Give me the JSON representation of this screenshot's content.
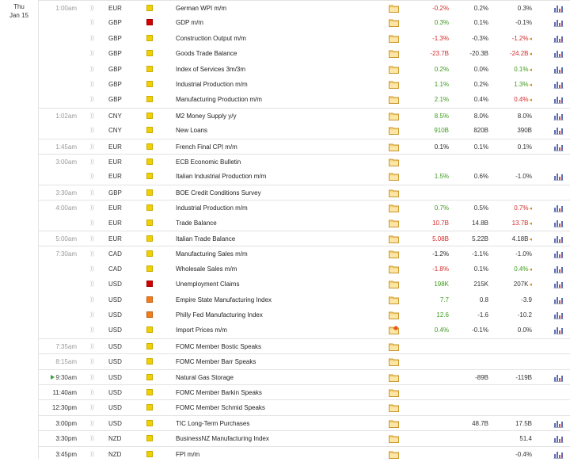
{
  "day": {
    "weekday": "Thu",
    "date": "Jan 15"
  },
  "colors": {
    "positive": "#3c9a1c",
    "negative": "#d42a2a",
    "low_impact": "#f0d000",
    "medium_impact": "#f07c1c",
    "high_impact": "#d40000"
  },
  "icons": {
    "speaker": "speaker-icon",
    "document": "document-icon",
    "chart": "bar-chart-icon",
    "live": "play-icon",
    "revised": "revised-flag-icon"
  },
  "rows": [
    {
      "time": "1:00am",
      "ccy": "EUR",
      "impact": "low",
      "event": "German WPI m/m",
      "actual": "-0.2%",
      "actual_dir": "neg",
      "forecast": "0.2%",
      "previous": "0.3%",
      "rev": false,
      "chart": true,
      "group": true
    },
    {
      "time": "",
      "ccy": "GBP",
      "impact": "high",
      "event": "GDP m/m",
      "actual": "0.3%",
      "actual_dir": "pos",
      "forecast": "0.1%",
      "previous": "-0.1%",
      "rev": false,
      "chart": true
    },
    {
      "time": "",
      "ccy": "GBP",
      "impact": "low",
      "event": "Construction Output m/m",
      "actual": "-1.3%",
      "actual_dir": "neg",
      "forecast": "-0.3%",
      "previous": "-1.2%",
      "previous_dir": "neg",
      "rev": true,
      "chart": true
    },
    {
      "time": "",
      "ccy": "GBP",
      "impact": "low",
      "event": "Goods Trade Balance",
      "actual": "-23.7B",
      "actual_dir": "neg",
      "forecast": "-20.3B",
      "previous": "-24.2B",
      "previous_dir": "neg",
      "rev": true,
      "chart": true
    },
    {
      "time": "",
      "ccy": "GBP",
      "impact": "low",
      "event": "Index of Services 3m/3m",
      "actual": "0.2%",
      "actual_dir": "pos",
      "forecast": "0.0%",
      "previous": "0.1%",
      "previous_dir": "pos",
      "rev": true,
      "chart": true
    },
    {
      "time": "",
      "ccy": "GBP",
      "impact": "low",
      "event": "Industrial Production m/m",
      "actual": "1.1%",
      "actual_dir": "pos",
      "forecast": "0.2%",
      "previous": "1.3%",
      "previous_dir": "pos",
      "rev": true,
      "chart": true
    },
    {
      "time": "",
      "ccy": "GBP",
      "impact": "low",
      "event": "Manufacturing Production m/m",
      "actual": "2.1%",
      "actual_dir": "pos",
      "forecast": "0.4%",
      "previous": "0.4%",
      "previous_dir": "neg",
      "rev": true,
      "chart": true
    },
    {
      "time": "1:02am",
      "ccy": "CNY",
      "impact": "low",
      "event": "M2 Money Supply y/y",
      "actual": "8.5%",
      "actual_dir": "pos",
      "forecast": "8.0%",
      "previous": "8.0%",
      "rev": false,
      "chart": true,
      "group": true
    },
    {
      "time": "",
      "ccy": "CNY",
      "impact": "low",
      "event": "New Loans",
      "actual": "910B",
      "actual_dir": "pos",
      "forecast": "820B",
      "previous": "390B",
      "rev": false,
      "chart": true
    },
    {
      "time": "1:45am",
      "ccy": "EUR",
      "impact": "low",
      "event": "French Final CPI m/m",
      "actual": "0.1%",
      "actual_dir": "",
      "forecast": "0.1%",
      "previous": "0.1%",
      "rev": false,
      "chart": true,
      "group": true
    },
    {
      "time": "3:00am",
      "ccy": "EUR",
      "impact": "low",
      "event": "ECB Economic Bulletin",
      "actual": "",
      "forecast": "",
      "previous": "",
      "rev": false,
      "chart": false,
      "group": true
    },
    {
      "time": "",
      "ccy": "EUR",
      "impact": "low",
      "event": "Italian Industrial Production m/m",
      "actual": "1.5%",
      "actual_dir": "pos",
      "forecast": "0.6%",
      "previous": "-1.0%",
      "rev": false,
      "chart": true
    },
    {
      "time": "3:30am",
      "ccy": "GBP",
      "impact": "low",
      "event": "BOE Credit Conditions Survey",
      "actual": "",
      "forecast": "",
      "previous": "",
      "rev": false,
      "chart": false,
      "group": true
    },
    {
      "time": "4:00am",
      "ccy": "EUR",
      "impact": "low",
      "event": "Industrial Production m/m",
      "actual": "0.7%",
      "actual_dir": "pos",
      "forecast": "0.5%",
      "previous": "0.7%",
      "previous_dir": "neg",
      "rev": true,
      "chart": true,
      "group": true
    },
    {
      "time": "",
      "ccy": "EUR",
      "impact": "low",
      "event": "Trade Balance",
      "actual": "10.7B",
      "actual_dir": "neg",
      "forecast": "14.8B",
      "previous": "13.7B",
      "previous_dir": "neg",
      "rev": true,
      "chart": true
    },
    {
      "time": "5:00am",
      "ccy": "EUR",
      "impact": "low",
      "event": "Italian Trade Balance",
      "actual": "5.08B",
      "actual_dir": "neg",
      "forecast": "5.22B",
      "previous": "4.18B",
      "rev": true,
      "chart": true,
      "group": true
    },
    {
      "time": "7:30am",
      "ccy": "CAD",
      "impact": "low",
      "event": "Manufacturing Sales m/m",
      "actual": "-1.2%",
      "actual_dir": "",
      "forecast": "-1.1%",
      "previous": "-1.0%",
      "rev": false,
      "chart": true,
      "group": true
    },
    {
      "time": "",
      "ccy": "CAD",
      "impact": "low",
      "event": "Wholesale Sales m/m",
      "actual": "-1.8%",
      "actual_dir": "neg",
      "forecast": "0.1%",
      "previous": "0.4%",
      "previous_dir": "pos",
      "rev": true,
      "chart": true
    },
    {
      "time": "",
      "ccy": "USD",
      "impact": "high",
      "event": "Unemployment Claims",
      "actual": "198K",
      "actual_dir": "pos",
      "forecast": "215K",
      "previous": "207K",
      "rev": true,
      "chart": true
    },
    {
      "time": "",
      "ccy": "USD",
      "impact": "med",
      "event": "Empire State Manufacturing Index",
      "actual": "7.7",
      "actual_dir": "pos",
      "forecast": "0.8",
      "previous": "-3.9",
      "rev": false,
      "chart": true
    },
    {
      "time": "",
      "ccy": "USD",
      "impact": "med",
      "event": "Philly Fed Manufacturing Index",
      "actual": "12.6",
      "actual_dir": "pos",
      "forecast": "-1.6",
      "previous": "-10.2",
      "rev": false,
      "chart": true
    },
    {
      "time": "",
      "ccy": "USD",
      "impact": "low",
      "event": "Import Prices m/m",
      "actual": "0.4%",
      "actual_dir": "pos",
      "forecast": "-0.1%",
      "previous": "0.0%",
      "rev": false,
      "chart": true,
      "star": true
    },
    {
      "time": "7:35am",
      "ccy": "USD",
      "impact": "low",
      "event": "FOMC Member Bostic Speaks",
      "actual": "",
      "forecast": "",
      "previous": "",
      "rev": false,
      "chart": false,
      "group": true
    },
    {
      "time": "8:15am",
      "ccy": "USD",
      "impact": "low",
      "event": "FOMC Member Barr Speaks",
      "actual": "",
      "forecast": "",
      "previous": "",
      "rev": false,
      "chart": false,
      "group": true
    },
    {
      "time": "9:30am",
      "ccy": "USD",
      "impact": "low",
      "event": "Natural Gas Storage",
      "actual": "",
      "forecast": "-89B",
      "previous": "-119B",
      "rev": false,
      "chart": true,
      "group": true,
      "live": true
    },
    {
      "time": "11:40am",
      "ccy": "USD",
      "impact": "low",
      "event": "FOMC Member Barkin Speaks",
      "actual": "",
      "forecast": "",
      "previous": "",
      "rev": false,
      "chart": false,
      "group": true,
      "strong": true
    },
    {
      "time": "12:30pm",
      "ccy": "USD",
      "impact": "low",
      "event": "FOMC Member Schmid Speaks",
      "actual": "",
      "forecast": "",
      "previous": "",
      "rev": false,
      "chart": false,
      "group": true,
      "strong": true
    },
    {
      "time": "3:00pm",
      "ccy": "USD",
      "impact": "low",
      "event": "TIC Long-Term Purchases",
      "actual": "",
      "forecast": "48.7B",
      "previous": "17.5B",
      "rev": false,
      "chart": true,
      "group": true,
      "strong": true
    },
    {
      "time": "3:30pm",
      "ccy": "NZD",
      "impact": "low",
      "event": "BusinessNZ Manufacturing Index",
      "actual": "",
      "forecast": "",
      "previous": "51.4",
      "rev": false,
      "chart": true,
      "group": true,
      "strong": true
    },
    {
      "time": "3:45pm",
      "ccy": "NZD",
      "impact": "low",
      "event": "FPI m/m",
      "actual": "",
      "forecast": "",
      "previous": "-0.4%",
      "rev": false,
      "chart": true,
      "group": true,
      "strong": true
    }
  ]
}
